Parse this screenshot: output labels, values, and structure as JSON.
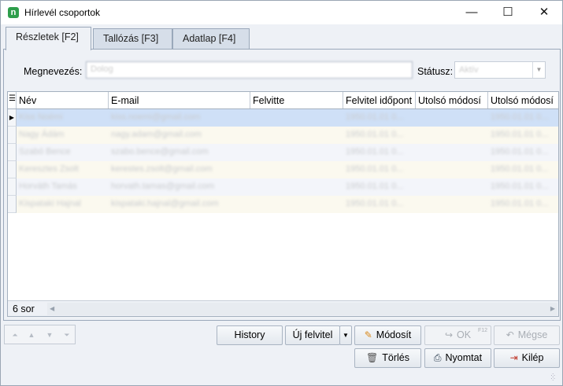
{
  "window": {
    "title": "Hírlevél csoportok",
    "minimize": "—",
    "maximize": "☐",
    "close": "✕",
    "icon_letter": "n"
  },
  "tabs": [
    {
      "label": "Részletek [F2]"
    },
    {
      "label": "Tallózás [F3]"
    },
    {
      "label": "Adatlap [F4]"
    }
  ],
  "form": {
    "name_label": "Megnevezés:",
    "name_value": "Dolog",
    "status_label": "Státusz:",
    "status_value": "Aktív"
  },
  "grid": {
    "columns": [
      "Név",
      "E-mail",
      "Felvitte",
      "Felvitel időpont",
      "Utolsó módosí",
      "Utolsó módosí"
    ],
    "rows": [
      {
        "name": "Kiss Noémi",
        "email": "kiss.noemi@gmail.com",
        "by": "",
        "date": "1950.01.01 0...",
        "mod1": "",
        "mod2": "1950.01.01 0..."
      },
      {
        "name": "Nagy Ádám",
        "email": "nagy.adam@gmail.com",
        "by": "",
        "date": "1950.01.01 0...",
        "mod1": "",
        "mod2": "1950.01.01 0..."
      },
      {
        "name": "Szabó Bence",
        "email": "szabo.bence@gmail.com",
        "by": "",
        "date": "1950.01.01 0...",
        "mod1": "",
        "mod2": "1950.01.01 0..."
      },
      {
        "name": "Keresztes Zsolt",
        "email": "kerestes.zsolt@gmail.com",
        "by": "",
        "date": "1950.01.01 0...",
        "mod1": "",
        "mod2": "1950.01.01 0..."
      },
      {
        "name": "Horváth Tamás",
        "email": "horvath.tamas@gmail.com",
        "by": "",
        "date": "1950.01.01 0...",
        "mod1": "",
        "mod2": "1950.01.01 0..."
      },
      {
        "name": "Kispataki Hajnal",
        "email": "kispataki.hajnal@gmail.com",
        "by": "",
        "date": "1950.01.01 0...",
        "mod1": "",
        "mod2": "1950.01.01 0..."
      }
    ],
    "row_count": "6 sor"
  },
  "buttons": {
    "history": "History",
    "new": "Új felvitel",
    "edit": "Módosít",
    "ok": "OK",
    "ok_key": "F12",
    "cancel": "Mégse",
    "delete": "Törlés",
    "print": "Nyomtat",
    "exit": "Kilép"
  },
  "colors": {
    "selected_row": "#cfe0f7",
    "alt_row": "#fbf9ef",
    "row_band": "#f3f5fa",
    "accent_green": "#2e9e4b"
  }
}
